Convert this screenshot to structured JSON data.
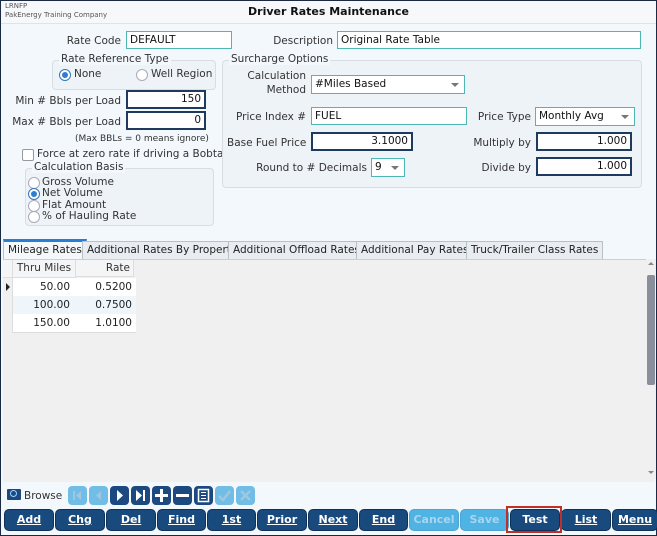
{
  "header": {
    "company_code": "LRNFP",
    "company_name": "PakEnergy Training Company",
    "title": "Driver Rates Maintenance"
  },
  "form": {
    "rate_code_label": "Rate Code",
    "rate_code_value": "DEFAULT",
    "description_label": "Description",
    "description_value": "Original Rate Table",
    "rate_reference_type": {
      "title": "Rate Reference Type",
      "options": [
        "None",
        "Well Region"
      ],
      "selected": "None"
    },
    "min_bbls_label": "Min # Bbls per Load",
    "min_bbls_value": "150",
    "max_bbls_label": "Max # Bbls per Load",
    "max_bbls_value": "0",
    "max_note": "(Max BBLs = 0 means ignore)",
    "force_zero_label": "Force at zero rate if driving a Bobtail",
    "force_zero_checked": false,
    "calculation_basis": {
      "title": "Calculation Basis",
      "options": [
        "Gross Volume",
        "Net Volume",
        "Flat Amount",
        "% of Hauling Rate"
      ],
      "selected": "Net Volume"
    },
    "surcharge": {
      "title": "Surcharge Options",
      "calc_method_label_1": "Calculation",
      "calc_method_label_2": "Method",
      "calc_method_value": "#Miles Based",
      "price_index_label": "Price Index #",
      "price_index_value": "FUEL",
      "price_type_label": "Price Type",
      "price_type_value": "Monthly Avg",
      "base_fuel_label": "Base Fuel Price",
      "base_fuel_value": "3.1000",
      "multiply_label": "Multiply by",
      "multiply_value": "1.000",
      "round_label": "Round to # Decimals",
      "round_value": "9",
      "divide_label": "Divide by",
      "divide_value": "1.000"
    }
  },
  "tabs": [
    {
      "label": "Mileage Rates",
      "active": true
    },
    {
      "label": "Additional Rates By Property",
      "active": false
    },
    {
      "label": "Additional Offload Rates",
      "active": false
    },
    {
      "label": "Additional Pay Rates",
      "active": false
    },
    {
      "label": "Truck/Trailer Class Rates",
      "active": false
    }
  ],
  "grid": {
    "columns": [
      "Thru Miles",
      "Rate"
    ],
    "rows": [
      {
        "miles": "50.00",
        "rate": "0.5200"
      },
      {
        "miles": "100.00",
        "rate": "0.7500"
      },
      {
        "miles": "150.00",
        "rate": "1.0100"
      }
    ]
  },
  "navigator": {
    "browse_label": "Browse",
    "buttons": [
      {
        "name": "first",
        "enabled": false
      },
      {
        "name": "prior",
        "enabled": false
      },
      {
        "name": "next",
        "enabled": true
      },
      {
        "name": "last",
        "enabled": true
      },
      {
        "name": "insert",
        "enabled": true
      },
      {
        "name": "delete",
        "enabled": true
      },
      {
        "name": "edit",
        "enabled": true
      },
      {
        "name": "post",
        "enabled": false
      },
      {
        "name": "cancel",
        "enabled": false
      }
    ]
  },
  "buttons": [
    {
      "label": "Add",
      "hot": "A",
      "enabled": true
    },
    {
      "label": "Chg",
      "hot": "C",
      "enabled": true
    },
    {
      "label": "Del",
      "hot": "D",
      "enabled": true
    },
    {
      "label": "Find",
      "hot": "F",
      "enabled": true
    },
    {
      "label": "1st",
      "hot": "1",
      "enabled": true
    },
    {
      "label": "Prior",
      "hot": "P",
      "enabled": true
    },
    {
      "label": "Next",
      "hot": "N",
      "enabled": true
    },
    {
      "label": "End",
      "hot": "E",
      "enabled": true
    },
    {
      "label": "Cancel",
      "hot": "",
      "enabled": false
    },
    {
      "label": "Save",
      "hot": "",
      "enabled": false
    },
    {
      "label": "Test",
      "hot": "",
      "enabled": true,
      "highlighted": true
    },
    {
      "label": "List",
      "hot": "L",
      "enabled": true
    },
    {
      "label": "Menu",
      "hot": "M",
      "enabled": true
    }
  ],
  "colors": {
    "button_bg": "#184a7d",
    "button_disabled_bg": "#4fb3e3",
    "input_border": "#4cb7b3",
    "highlight": "#c0302a",
    "tab_active_accent": "#2a7dd1"
  }
}
